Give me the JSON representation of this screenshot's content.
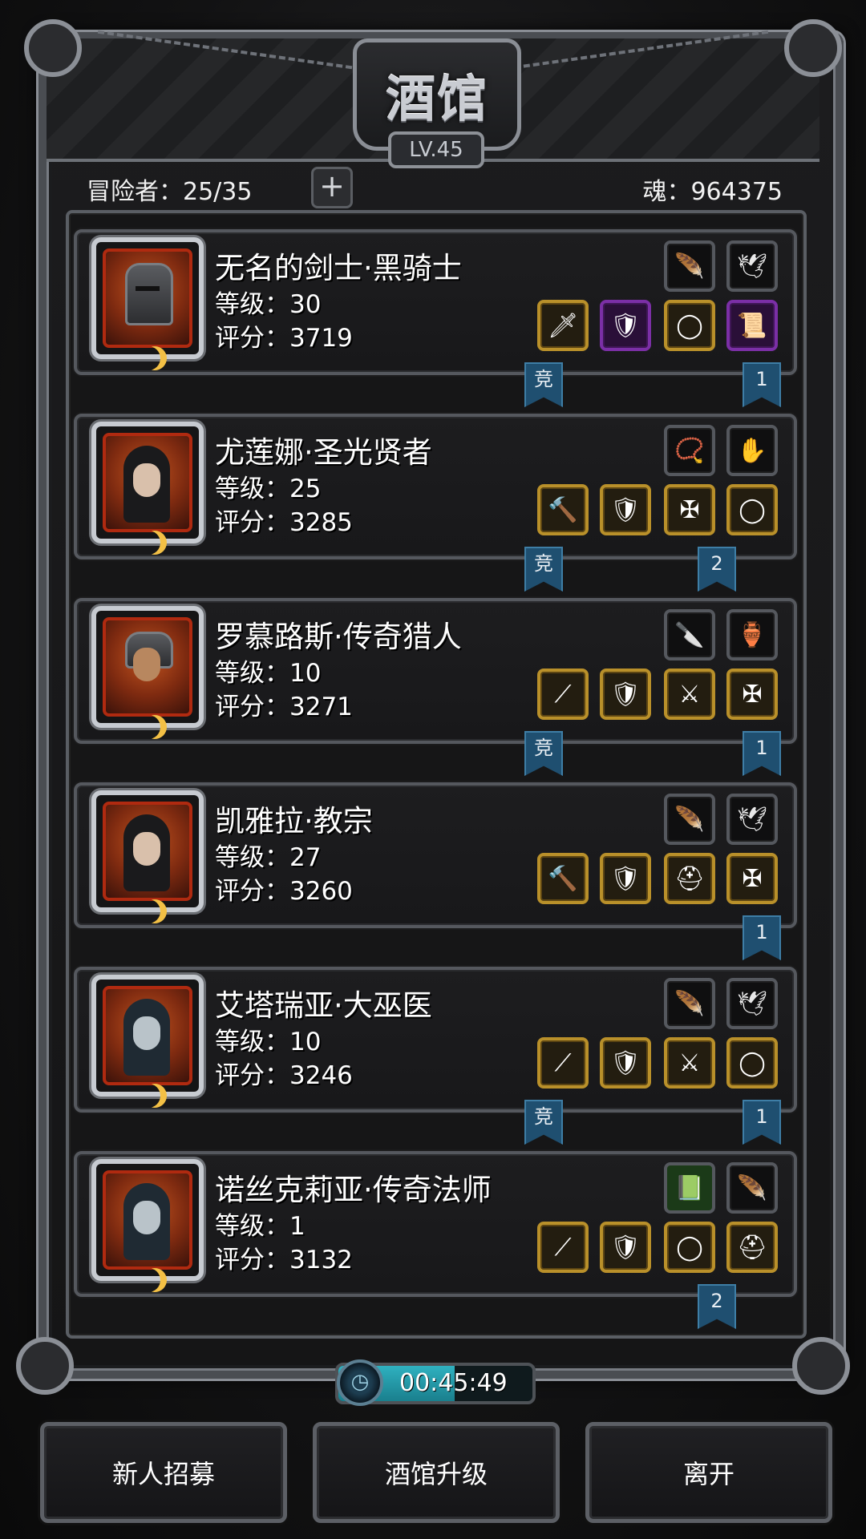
{
  "header": {
    "title": "酒馆",
    "level": "LV.45"
  },
  "info": {
    "adventurers": "冒险者：25/35",
    "souls": "魂：964375"
  },
  "heroes": [
    {
      "name": "无名的剑士·黑骑士",
      "level": "等级：30",
      "score": "评分：3719",
      "badge": "竞",
      "rank": "1"
    },
    {
      "name": "尤莲娜·圣光贤者",
      "level": "等级：25",
      "score": "评分：3285",
      "badge": "竞",
      "rank": "2"
    },
    {
      "name": "罗慕路斯·传奇猎人",
      "level": "等级：10",
      "score": "评分：3271",
      "badge": "竞",
      "rank": "1"
    },
    {
      "name": "凯雅拉·教宗",
      "level": "等级：27",
      "score": "评分：3260",
      "badge": "",
      "rank": "1"
    },
    {
      "name": "艾塔瑞亚·大巫医",
      "level": "等级：10",
      "score": "评分：3246",
      "badge": "竞",
      "rank": "1"
    },
    {
      "name": "诺丝克莉亚·传奇法师",
      "level": "等级：1",
      "score": "评分：3132",
      "badge": "",
      "rank": "2"
    }
  ],
  "equipment_icons": {
    "card1": [
      "feather-icon",
      "wing-icon",
      "sword-icon",
      "armor-icon",
      "ring-icon",
      "scroll-icon"
    ],
    "card2": [
      "necklace-icon",
      "glove-icon",
      "hammer-icon",
      "armor-icon",
      "amulet-icon",
      "ring-icon"
    ],
    "card3": [
      "dagger-icon",
      "potion-icon",
      "spear-icon",
      "armor-icon",
      "claw-icon",
      "amulet-icon"
    ],
    "card4": [
      "feather-icon",
      "wing-icon",
      "hammer-icon",
      "armor-icon",
      "helmet-icon",
      "amulet-icon"
    ],
    "card5": [
      "feather-icon",
      "wing-icon",
      "staff-icon",
      "armor-icon",
      "claw-icon",
      "ring-icon"
    ],
    "card6": [
      "book-icon",
      "feather-icon",
      "staff-icon",
      "armor-icon",
      "ring-icon",
      "helmet-icon"
    ]
  },
  "timer": {
    "text": "00:45:49",
    "progress": 0.6
  },
  "buttons": {
    "recruit": "新人招募",
    "upgrade": "酒馆升级",
    "leave": "离开"
  },
  "colors": {
    "flag": "#1f4f70",
    "gold_border": "#b9902a",
    "purple_border": "#7b2fa6",
    "timer_fill": "#2fb1c0"
  }
}
